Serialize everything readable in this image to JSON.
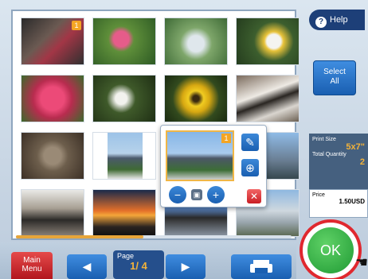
{
  "header": {
    "help_label": "Help"
  },
  "side": {
    "select_all_line1": "Select",
    "select_all_line2": "All",
    "print_size_label": "Print Size",
    "print_size_value": "5x7\"",
    "total_quantity_label": "Total Quantity",
    "total_quantity_value": "2",
    "price_label": "Price",
    "price_value": "1.50USD"
  },
  "ok_label": "OK",
  "footer": {
    "main_menu_line1": "Main",
    "main_menu_line2": "Menu",
    "page_label": "Page",
    "page_value": "1/ 4"
  },
  "popup": {
    "badge": "1"
  },
  "thumb_badges": {
    "t1": "1",
    "t11": "1"
  },
  "colors": {
    "accent_blue": "#1a5fb1",
    "ok_green": "#1f9a34",
    "ring_red": "#e0282f",
    "highlight_orange": "#f2b23a"
  },
  "icons": [
    "help-icon",
    "pencil-icon",
    "zoom-in-icon",
    "zoom-out-icon",
    "rotate-icon",
    "delete-icon",
    "prev-arrow-icon",
    "next-arrow-icon",
    "printer-icon",
    "cursor-icon"
  ]
}
